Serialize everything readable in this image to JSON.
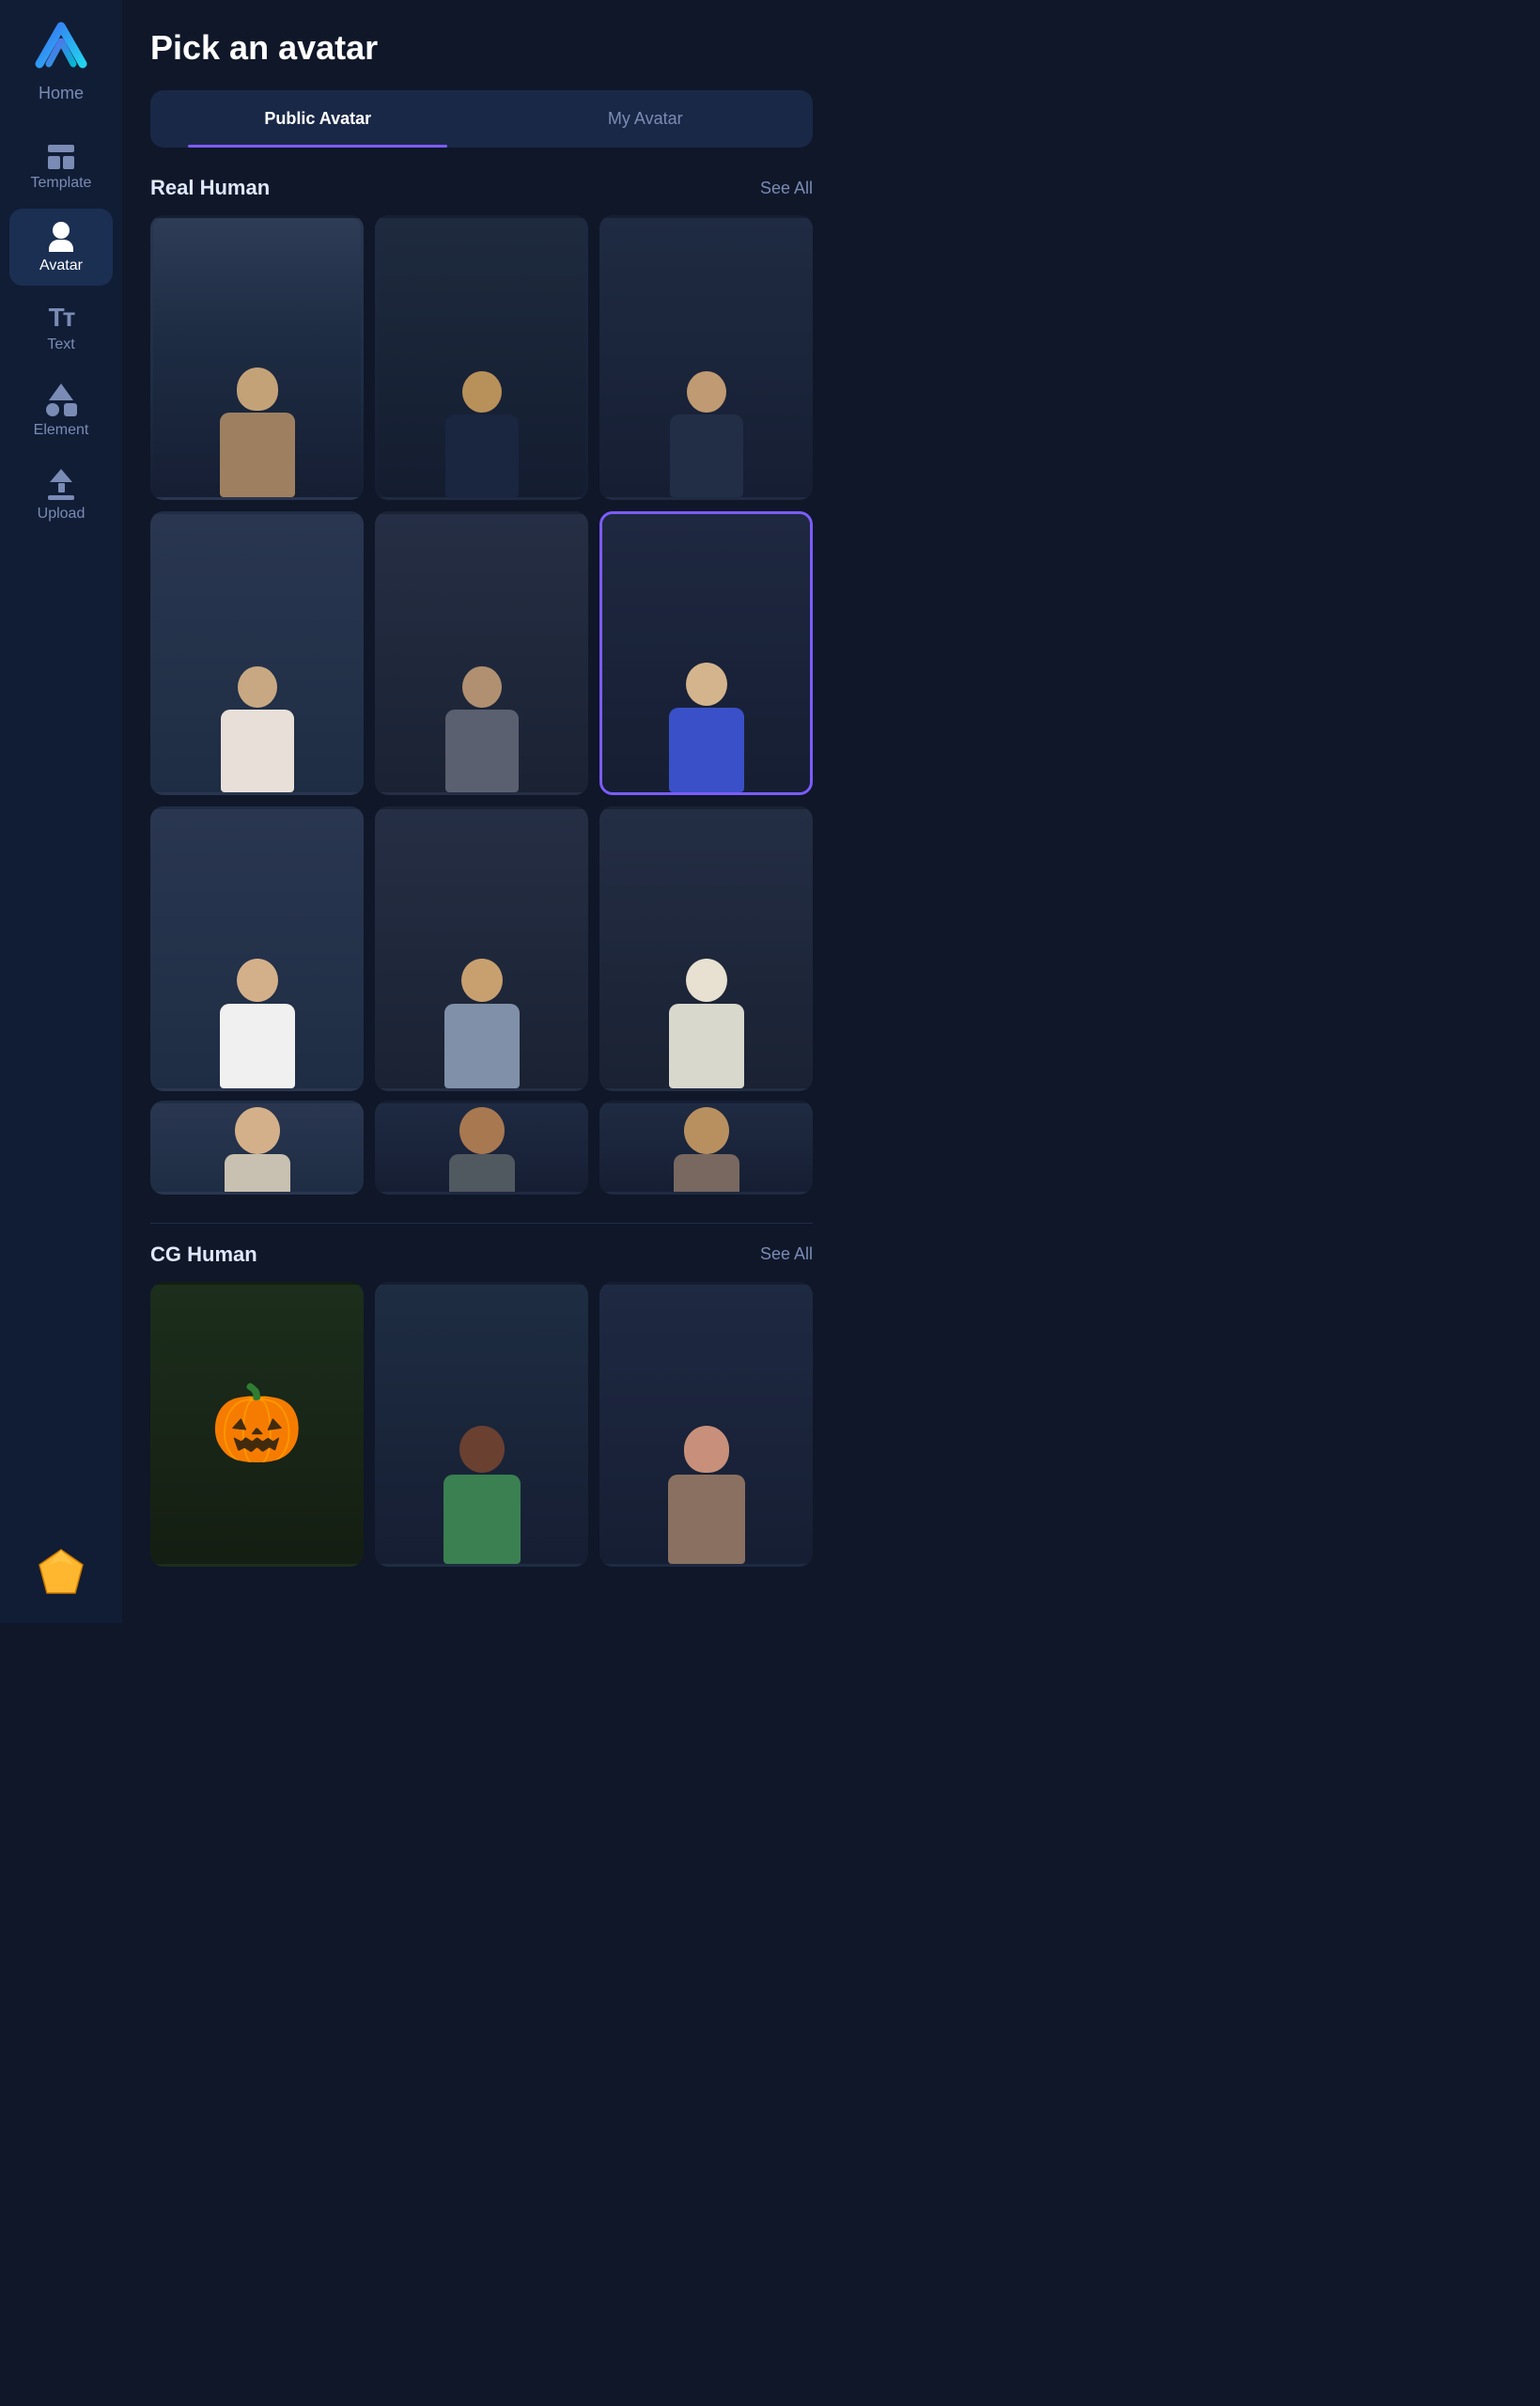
{
  "app": {
    "logo_alt": "HeyGen logo"
  },
  "sidebar": {
    "home_label": "Home",
    "items": [
      {
        "id": "template",
        "label": "Template",
        "active": false
      },
      {
        "id": "avatar",
        "label": "Avatar",
        "active": true
      },
      {
        "id": "text",
        "label": "Text",
        "active": false
      },
      {
        "id": "element",
        "label": "Element",
        "active": false
      },
      {
        "id": "upload",
        "label": "Upload",
        "active": false
      }
    ]
  },
  "main": {
    "page_title": "Pick an avatar",
    "tabs": [
      {
        "id": "public",
        "label": "Public Avatar",
        "active": true
      },
      {
        "id": "my",
        "label": "My Avatar",
        "active": false
      }
    ],
    "sections": [
      {
        "id": "real-human",
        "title": "Real Human",
        "see_all_label": "See All",
        "avatars": [
          {
            "id": "rh1",
            "style": "av1",
            "selected": false
          },
          {
            "id": "rh2",
            "style": "av2",
            "selected": false
          },
          {
            "id": "rh3",
            "style": "av3",
            "selected": false
          },
          {
            "id": "rh4",
            "style": "av4",
            "selected": false
          },
          {
            "id": "rh5",
            "style": "av5",
            "selected": false
          },
          {
            "id": "rh6",
            "style": "av6",
            "selected": true
          },
          {
            "id": "rh7",
            "style": "av7",
            "selected": false
          },
          {
            "id": "rh8",
            "style": "av8",
            "selected": false
          },
          {
            "id": "rh9",
            "style": "av9",
            "selected": false
          }
        ],
        "partial_avatars": [
          {
            "id": "rh10",
            "style": "av1"
          },
          {
            "id": "rh11",
            "style": "av2"
          },
          {
            "id": "rh12",
            "style": "av3"
          }
        ]
      },
      {
        "id": "cg-human",
        "title": "CG Human",
        "see_all_label": "See All",
        "avatars": [
          {
            "id": "cg1",
            "style": "cg1",
            "selected": false
          },
          {
            "id": "cg2",
            "style": "cg2",
            "selected": false
          },
          {
            "id": "cg3",
            "style": "cg3",
            "selected": false
          }
        ]
      }
    ]
  },
  "colors": {
    "accent": "#7c5cfc",
    "bg_dark": "#0f1729",
    "bg_sidebar": "#111d35",
    "bg_card": "#1a2847",
    "text_muted": "#7a8bb5"
  }
}
